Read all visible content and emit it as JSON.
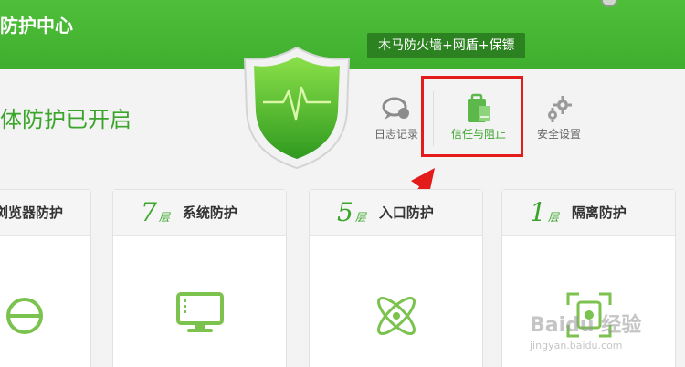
{
  "header": {
    "title": "防护中心",
    "feature_tag": "木马防火墙+网盾+保镖"
  },
  "status": {
    "text": "体防护已开启"
  },
  "toolbar": {
    "log_label": "日志记录",
    "trust_label": "信任与阻止",
    "settings_label": "安全设置"
  },
  "cards": [
    {
      "label": "浏览器防护",
      "number": "",
      "unit": "",
      "icon": "browser-e-icon"
    },
    {
      "label": "系统防护",
      "number": "7",
      "unit": "层",
      "icon": "monitor-icon"
    },
    {
      "label": "入口防护",
      "number": "5",
      "unit": "层",
      "icon": "atom-icon"
    },
    {
      "label": "隔离防护",
      "number": "1",
      "unit": "层",
      "icon": "isolation-icon"
    }
  ],
  "watermark": {
    "main": "Baidu 经验",
    "sub": "jingyan.baidu.com"
  },
  "colors": {
    "brand_green": "#3aa52a",
    "header_green": "#4fbf3a",
    "highlight_red": "#e41b1b"
  }
}
